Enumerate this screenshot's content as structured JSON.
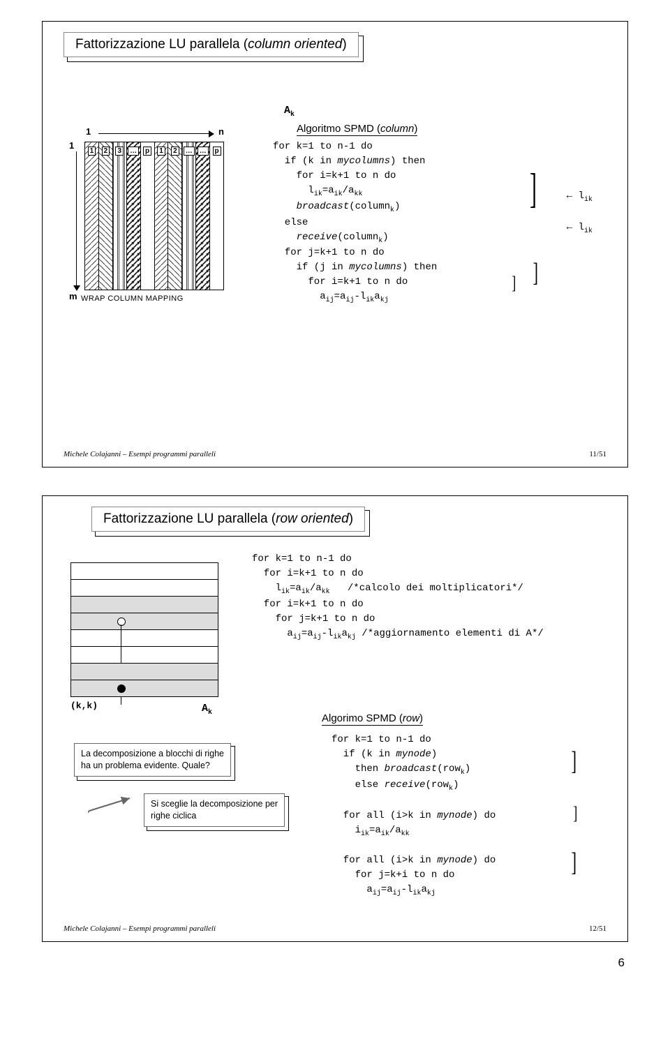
{
  "page_number": "6",
  "slide1": {
    "title_pre": "Fattorizzazione LU parallela (",
    "title_kw": "column oriented",
    "title_post": ")",
    "wrap_mapping": "WRAP COLUMN MAPPING",
    "matrix": {
      "top1": "1",
      "topn": "n",
      "left1": "1",
      "leftm": "m",
      "col_labels": [
        "1",
        "2",
        "3",
        "…",
        "p",
        "1",
        "2",
        "…",
        "…",
        "p"
      ]
    },
    "Ak": "A",
    "Ak_sub": "k",
    "algo_title_pre": "Algoritmo SPMD (",
    "algo_title_kw": "column",
    "algo_title_post": ")",
    "code_lines": [
      "for k=1 to n-1 do",
      "  if (k in <i>mycolumns</i>) then",
      "    for i=k+1 to n do",
      "      l<sub>ik</sub>=a<sub>ik</sub>/a<sub>kk</sub>",
      "    <i>broadcast</i>(column<sub>k</sub>)",
      "  else",
      "    <i>receive</i>(column<sub>k</sub>)",
      "  for j=k+1 to n do",
      "    if (j in <i>mycolumns</i>) then",
      "      for i=k+1 to n do",
      "        a<sub>ij</sub>=a<sub>ij</sub>-l<sub>ik</sub>a<sub>kj</sub>"
    ],
    "side_arrows": [
      "← l",
      "ik",
      "← l",
      "ik"
    ],
    "footer_left": "Michele Colajanni – Esempi programmi paralleli",
    "footer_right": "11/51"
  },
  "slide2": {
    "title_pre": "Fattorizzazione LU parallela (",
    "title_kw": "row oriented",
    "title_post": ")",
    "Ak": "A",
    "Ak_sub": "k",
    "kk": "(k,k)",
    "code1_lines": [
      "for k=1 to n-1 do",
      "  for i=k+1 to n do",
      "    l<sub>ik</sub>=a<sub>ik</sub>/a<sub>kk</sub>   /*calcolo dei moltiplicatori*/",
      "  for i=k+1 to n do",
      "    for j=k+1 to n do",
      "      a<sub>ij</sub>=a<sub>ij</sub>-l<sub>ik</sub>a<sub>kj</sub> /*aggiornamento elementi di A*/"
    ],
    "annot1_l1": "La decomposizione a blocchi di righe",
    "annot1_l2": "ha un problema evidente. Quale?",
    "annot2_l1": "Si sceglie la decomposizione per",
    "annot2_l2": "righe ciclica",
    "algo_title_pre": "Algorimo SPMD (",
    "algo_title_kw": "row",
    "algo_title_post": ")",
    "code2_lines": [
      "for k=1 to n-1 do",
      "  if (k in <i>mynode</i>)",
      "    then <i>broadcast</i>(row<sub>k</sub>)",
      "    else <i>receive</i>(row<sub>k</sub>)",
      "",
      "  for all (i>k in <i>mynode</i>) do",
      "    i<sub>ik</sub>=a<sub>ik</sub>/a<sub>kk</sub>",
      "",
      "  for all (i>k in <i>mynode</i>) do",
      "    for j=k+i to n do",
      "      a<sub>ij</sub>=a<sub>ij</sub>-l<sub>ik</sub>a<sub>kj</sub>"
    ],
    "footer_left": "Michele Colajanni – Esempi programmi paralleli",
    "footer_right": "12/51"
  }
}
